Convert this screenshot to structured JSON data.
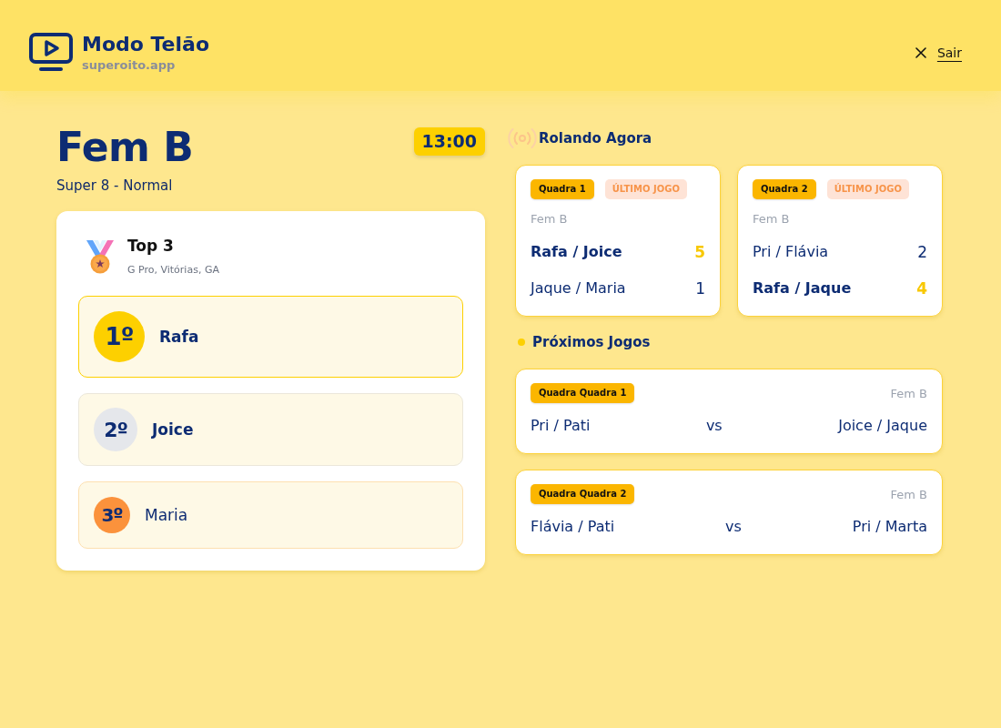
{
  "header": {
    "title": "Modo Telão",
    "subtitle": "superoito.app",
    "exit_label": "Sair"
  },
  "category": {
    "title": "Fem B",
    "subtitle": "Super 8 - Normal",
    "time": "13:00"
  },
  "top3": {
    "title": "Top 3",
    "criteria": "G Pro, Vitórias, GA",
    "podium": [
      {
        "position": "1º",
        "name": "Rafa",
        "color": "#fdd000"
      },
      {
        "position": "2º",
        "name": "Joice",
        "color": "#e5e7eb"
      },
      {
        "position": "3º",
        "name": "Maria",
        "color": "#fb923c"
      }
    ]
  },
  "live": {
    "title": "Rolando Agora",
    "games": [
      {
        "court": "Quadra 1",
        "tag": "ÚLTIMO JOGO",
        "category": "Fem B",
        "teams": [
          {
            "name": "Rafa / Joice",
            "score": "5",
            "winner": true
          },
          {
            "name": "Jaque / Maria",
            "score": "1",
            "winner": false
          }
        ]
      },
      {
        "court": "Quadra 2",
        "tag": "ÚLTIMO JOGO",
        "category": "Fem B",
        "teams": [
          {
            "name": "Pri / Flávia",
            "score": "2",
            "winner": false
          },
          {
            "name": "Rafa / Jaque",
            "score": "4",
            "winner": true
          }
        ]
      }
    ]
  },
  "upcoming": {
    "title": "Próximos Jogos",
    "games": [
      {
        "court": "Quadra Quadra 1",
        "category": "Fem B",
        "team_1": "Pri / Pati",
        "versus": "vs",
        "team_2": "Joice / Jaque"
      },
      {
        "court": "Quadra Quadra 2",
        "category": "Fem B",
        "team_1": "Flávia / Pati",
        "versus": "vs",
        "team_2": "Pri / Marta"
      }
    ]
  }
}
